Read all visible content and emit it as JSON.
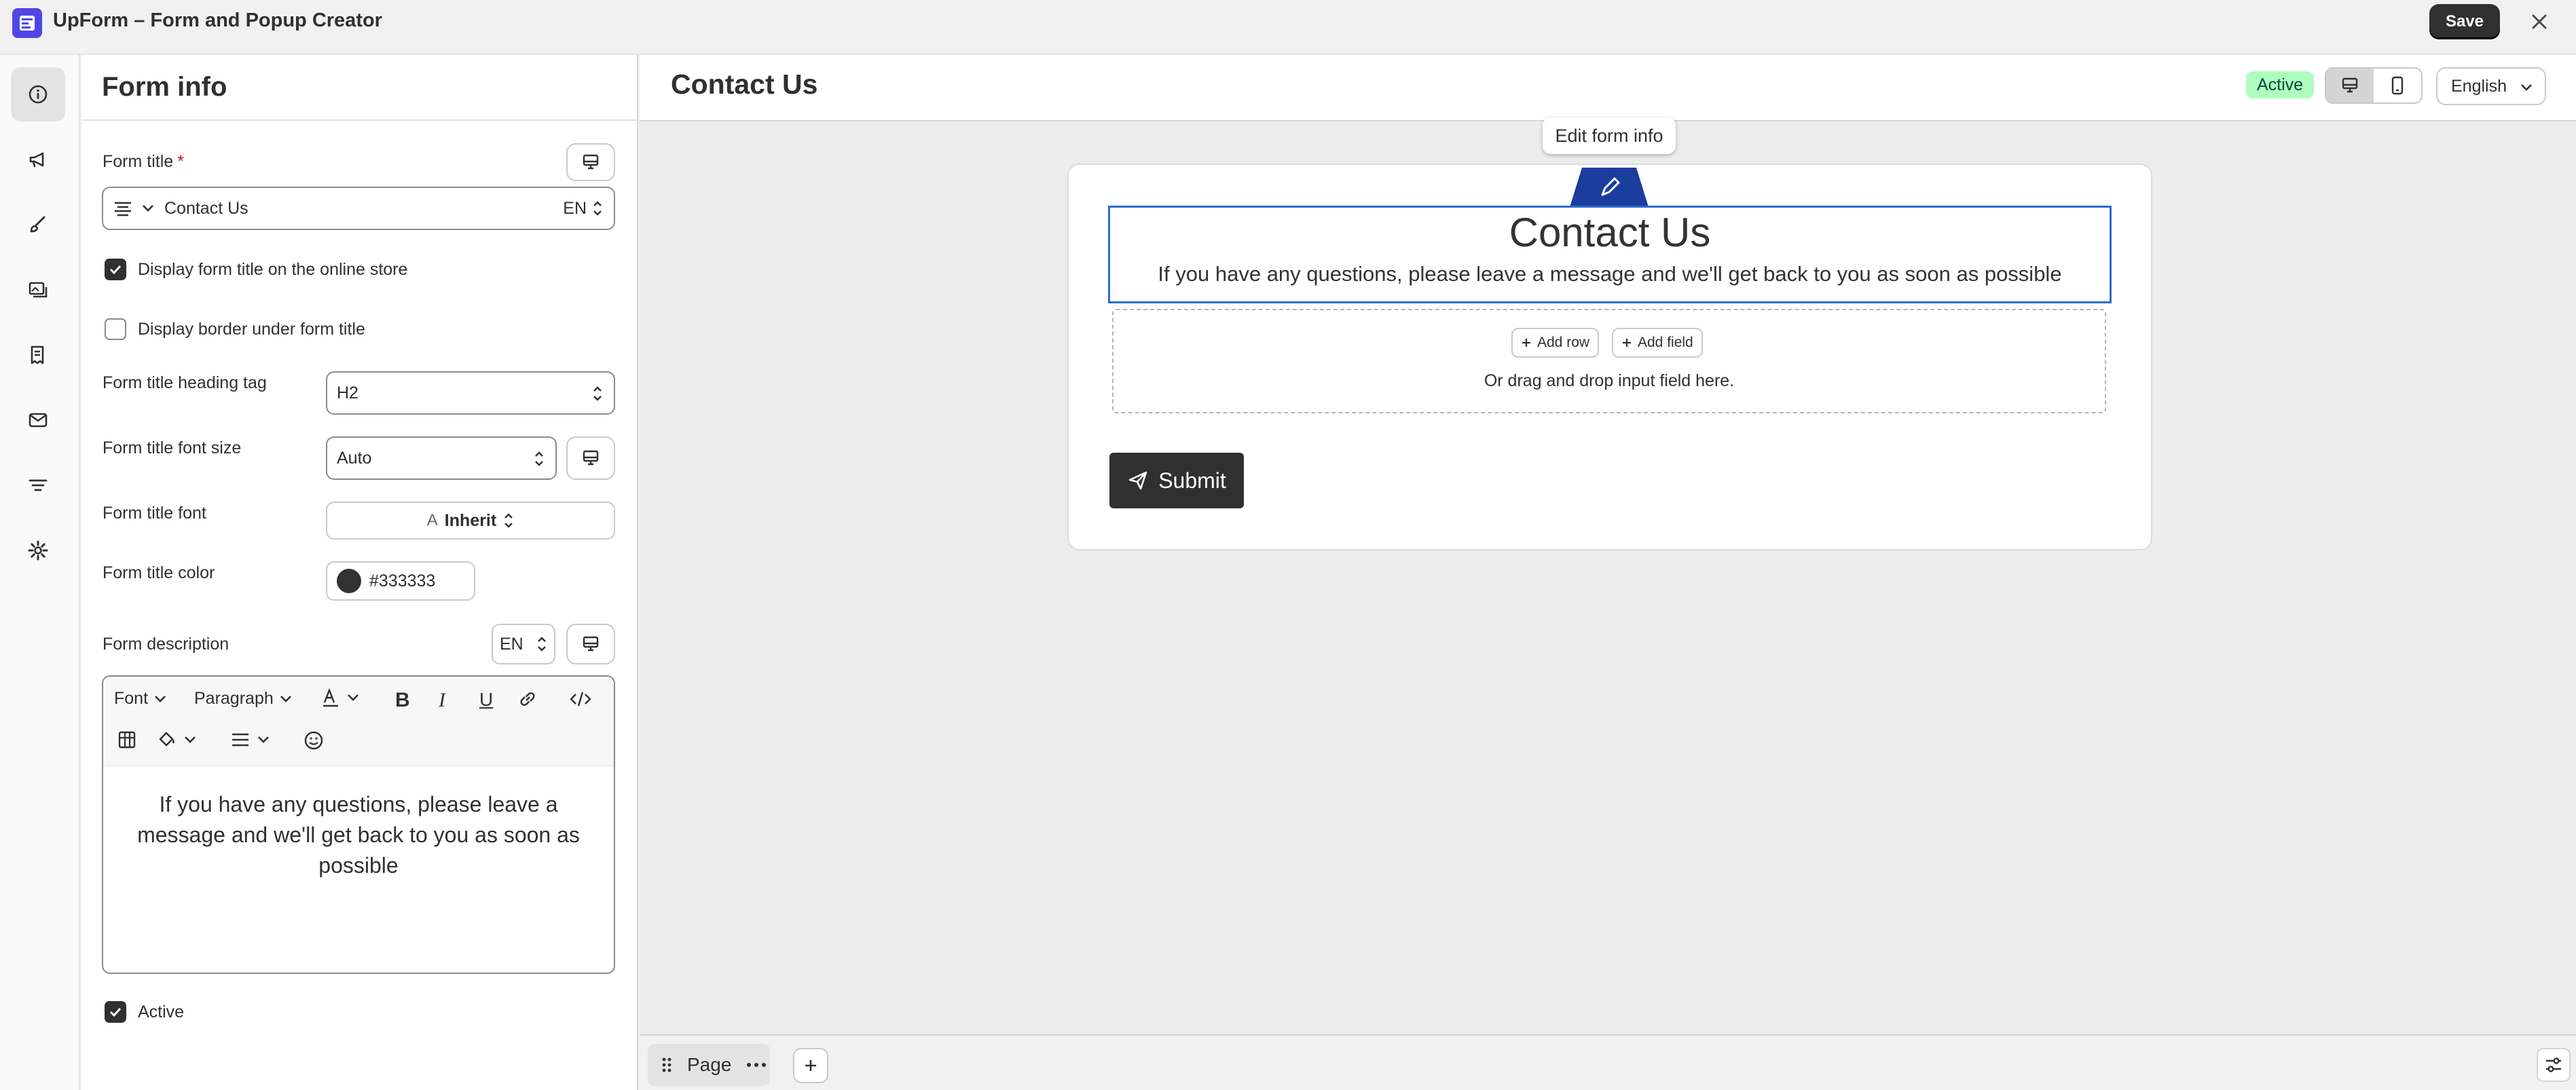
{
  "app": {
    "title": "UpForm – Form and Popup Creator",
    "save_label": "Save"
  },
  "panel": {
    "title": "Form info",
    "form_title_label": "Form title",
    "required_mark": "*",
    "form_title_value": "Contact Us",
    "form_title_lang": "EN",
    "display_title_label": "Display form title on the online store",
    "display_title_checked": true,
    "display_border_label": "Display border under form title",
    "display_border_checked": false,
    "heading_tag_label": "Form title heading tag",
    "heading_tag_value": "H2",
    "font_size_label": "Form title font size",
    "font_size_value": "Auto",
    "font_label": "Form title font",
    "font_value": "Inherit",
    "color_label": "Form title color",
    "color_value": "#333333",
    "description_label": "Form description",
    "description_lang": "EN",
    "toolbar": {
      "font": "Font",
      "paragraph": "Paragraph"
    },
    "description_text": "If you have any questions, please leave a message and we'll get back to you as soon as possible",
    "active_label": "Active",
    "active_checked": true
  },
  "preview": {
    "title": "Contact Us",
    "status_badge": "Active",
    "language": "English",
    "tooltip": "Edit form info",
    "form_title": "Contact Us",
    "form_description": "If you have any questions, please leave a message and we'll get back to you as soon as possible",
    "add_row": "Add row",
    "add_field": "Add field",
    "drop_hint": "Or drag and drop input field here.",
    "submit_label": "Submit"
  },
  "bottom": {
    "page_tab": "Page"
  },
  "colors": {
    "accent": "#2c6ecb",
    "edit_tab": "#1a3d9e",
    "badge_bg": "#affebf",
    "dark": "#303030",
    "title_color": "#333333"
  },
  "icons": {
    "rail": [
      "info-icon",
      "megaphone-icon",
      "brush-icon",
      "gallery-icon",
      "receipt-icon",
      "mail-icon",
      "filter-icon",
      "gear-icon"
    ]
  }
}
